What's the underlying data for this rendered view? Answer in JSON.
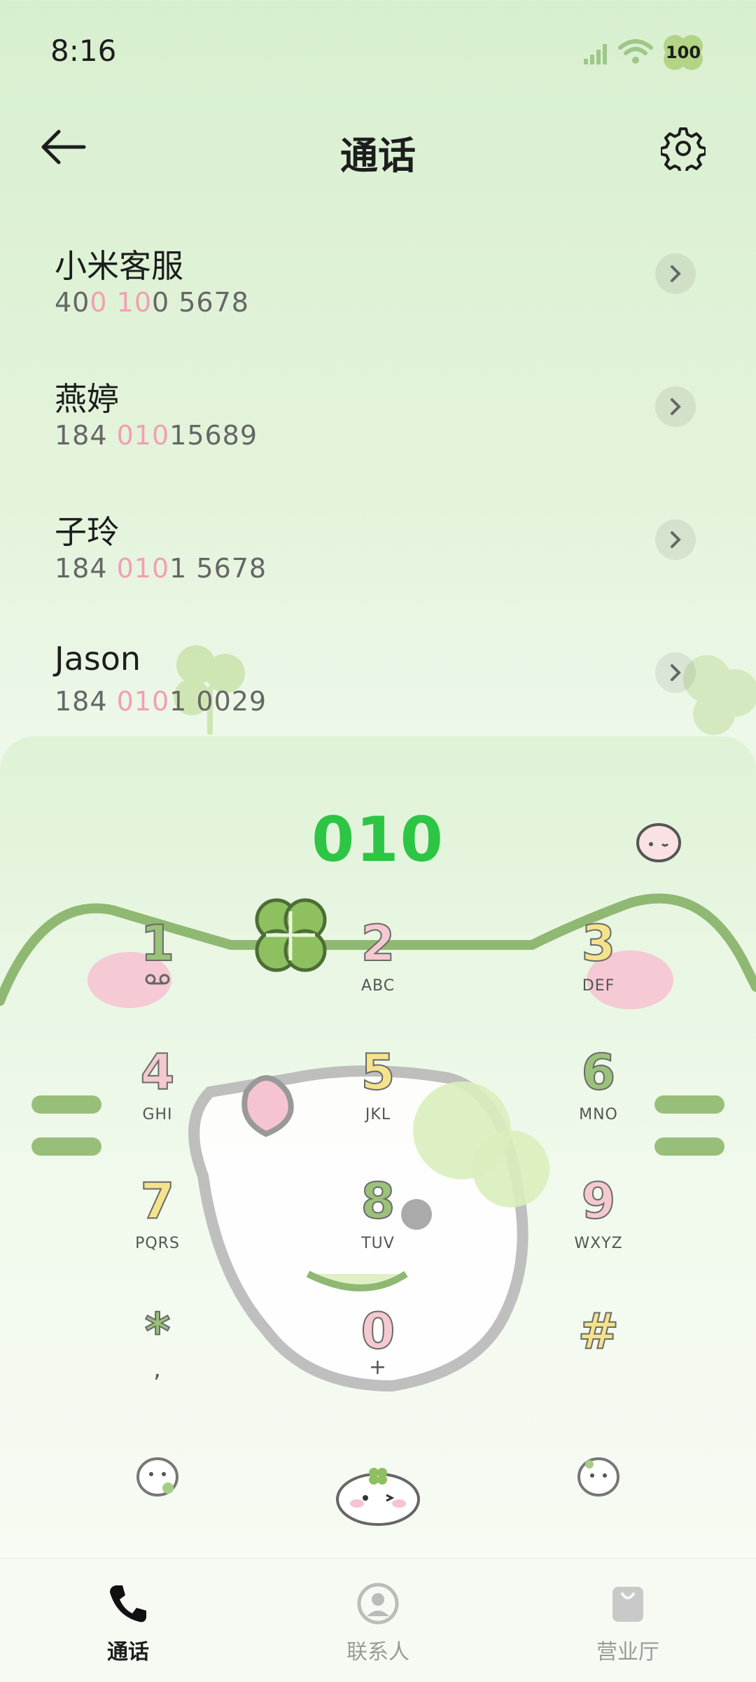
{
  "status": {
    "time": "8:16",
    "battery": "100"
  },
  "header": {
    "title": "通话"
  },
  "contacts": [
    {
      "name": "小米客服",
      "num_parts": [
        "40",
        "0",
        " ",
        "10",
        "0 5678"
      ]
    },
    {
      "name": "燕婷",
      "num_parts": [
        "184 ",
        "010",
        "15689"
      ]
    },
    {
      "name": "子玲",
      "num_parts": [
        "184 ",
        "010",
        "1 5678"
      ]
    },
    {
      "name": "Jason",
      "num_parts": [
        "184 ",
        "010",
        "1 0029"
      ]
    }
  ],
  "dialer": {
    "number": "010",
    "keys": [
      {
        "digit": "1",
        "letters": ""
      },
      {
        "digit": "2",
        "letters": "ABC"
      },
      {
        "digit": "3",
        "letters": "DEF"
      },
      {
        "digit": "4",
        "letters": "GHI"
      },
      {
        "digit": "5",
        "letters": "JKL"
      },
      {
        "digit": "6",
        "letters": "MNO"
      },
      {
        "digit": "7",
        "letters": "PQRS"
      },
      {
        "digit": "8",
        "letters": "TUV"
      },
      {
        "digit": "9",
        "letters": "WXYZ"
      },
      {
        "digit": "*",
        "letters": ","
      },
      {
        "digit": "0",
        "letters": "+"
      },
      {
        "digit": "#",
        "letters": ""
      }
    ]
  },
  "tabs": [
    {
      "label": "通话",
      "icon": "phone-icon",
      "active": true
    },
    {
      "label": "联系人",
      "icon": "person-icon",
      "active": false
    },
    {
      "label": "营业厅",
      "icon": "bag-icon",
      "active": false
    }
  ],
  "colors": {
    "accent": "#2dc544",
    "highlight": "#f29fb3",
    "leaf": "#9ac27a"
  }
}
